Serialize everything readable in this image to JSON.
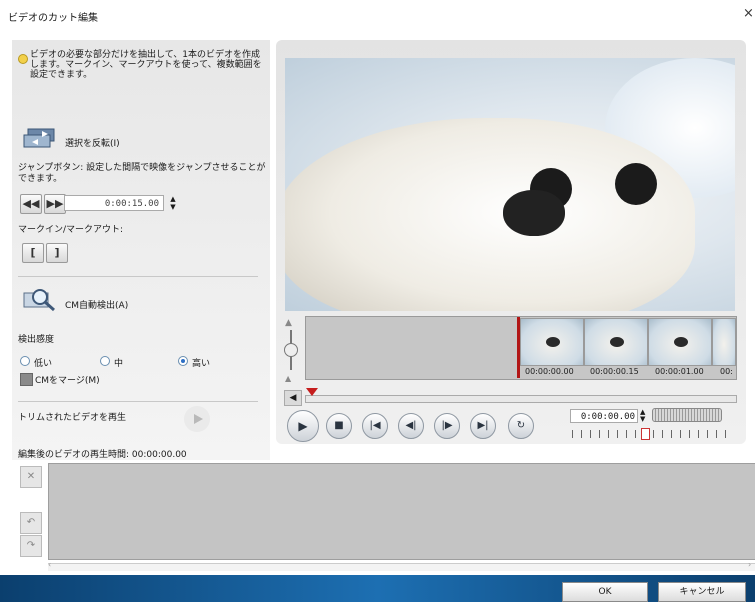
{
  "window": {
    "title": "ビデオのカット編集",
    "close": "×"
  },
  "left": {
    "hint": "ビデオの必要な部分だけを抽出して、1本のビデオを作成します。マークイン、マークアウトを使って、複数範囲を設定できます。",
    "reverse_selection": "選択を反転(I)",
    "jump_description": "ジャンプボタン: 設定した間隔で映像をジャンプさせることができます。",
    "jump_interval": "0:00:15.00",
    "markin_markout_label": "マークイン/マークアウト:",
    "mark_in_glyph": "[",
    "mark_out_glyph": "]",
    "cm_detect": "CM自動検出(A)",
    "sensitivity_label": "検出感度",
    "sensitivity_options": [
      "低い",
      "中",
      "高い"
    ],
    "sensitivity_selected": "高い",
    "cm_merge": "CMをマージ(M)",
    "play_trimmed": "トリムされたビデオを再生",
    "edited_duration_label": "編集後のビデオの再生時間:",
    "edited_duration_value": "00:00:00.00"
  },
  "player": {
    "timecodes": [
      "00:00:00.00",
      "00:00:00.15",
      "00:00:01.00",
      "00:"
    ],
    "current_time": "0:00:00.00",
    "controls": [
      "play",
      "stop",
      "prev-mark",
      "step-back",
      "step-forward",
      "next-mark",
      "repeat"
    ]
  },
  "footer": {
    "ok": "OK",
    "cancel": "キャンセル"
  },
  "colors": {
    "footer_accent": "#1d6fb2",
    "playhead": "#b21616"
  }
}
